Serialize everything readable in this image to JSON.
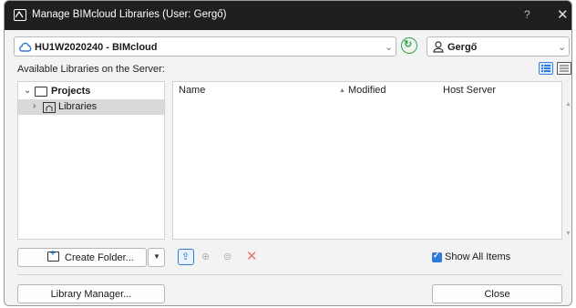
{
  "window": {
    "title": "Manage BIMcloud Libraries (User: Gergő)",
    "help": "?",
    "close": "✕"
  },
  "server": {
    "name": "HU1W2020240 - BIMcloud",
    "user": "Gergő"
  },
  "available_label": "Available Libraries on the Server:",
  "tree": {
    "items": [
      {
        "label": "Projects",
        "expanded": true,
        "bold": true
      },
      {
        "label": "Libraries",
        "expanded": false,
        "selected": true
      }
    ]
  },
  "list": {
    "columns": [
      "Name",
      "Modified",
      "Host Server"
    ],
    "sorted_column": "Modified",
    "rows": []
  },
  "toolbar": {
    "create_folder": "Create Folder...",
    "show_all_items": "Show All Items",
    "show_all_checked": true
  },
  "footer": {
    "library_manager": "Library Manager...",
    "close": "Close"
  },
  "colors": {
    "accent": "#2e7bd6",
    "refresh": "#2aa84a",
    "delete": "#e8796e",
    "titlebar": "#1f1f1f"
  }
}
